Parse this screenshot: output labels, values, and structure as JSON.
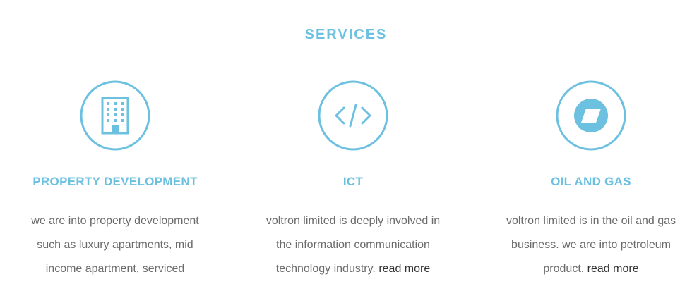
{
  "section": {
    "title": "SERVICES"
  },
  "services": [
    {
      "title": "PROPERTY DEVELOPMENT",
      "icon": "building-icon",
      "lines": [
        "we are into property development",
        "such as luxury apartments, mid",
        "income apartment, serviced"
      ],
      "read_more": ""
    },
    {
      "title": "ICT",
      "icon": "code-icon",
      "lines": [
        "voltron limited is deeply involved in",
        "the information communication",
        "technology industry."
      ],
      "read_more": "read more"
    },
    {
      "title": "OIL AND GAS",
      "icon": "oil-drop-icon",
      "lines": [
        "voltron limited is in the oil and gas",
        "business. we are into petroleum",
        "product."
      ],
      "read_more": "read more"
    }
  ],
  "colors": {
    "accent": "#6cc0e0",
    "body_text": "#6b6b6b",
    "link_text": "#333333"
  }
}
